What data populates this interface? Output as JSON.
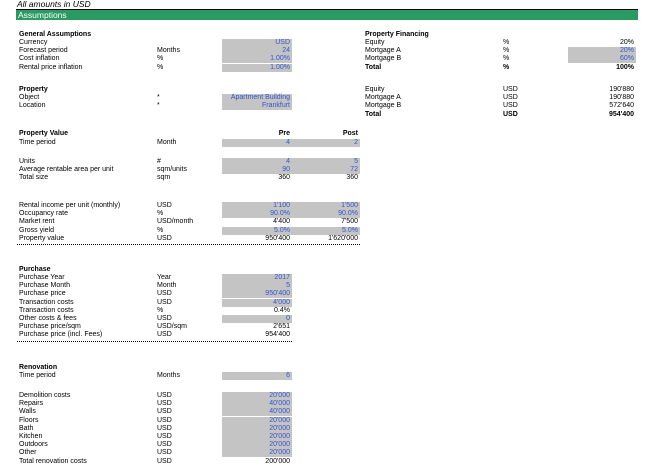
{
  "header": {
    "note": "All amounts in USD",
    "band": "Assumptions"
  },
  "general": {
    "title": "General Assumptions",
    "rows": [
      {
        "label": "Currency",
        "unit": "",
        "value": "USD"
      },
      {
        "label": "Forecast period",
        "unit": "Months",
        "value": "24"
      },
      {
        "label": "Cost inflation",
        "unit": "%",
        "value": "1.00%"
      },
      {
        "label": "Rental price inflation",
        "unit": "%",
        "value": "1.00%"
      }
    ]
  },
  "financing": {
    "title": "Property Financing",
    "rows": [
      {
        "label": "Equity",
        "unit": "%",
        "value": "20%"
      },
      {
        "label": "Mortgage A",
        "unit": "%",
        "value": "20%"
      },
      {
        "label": "Mortgage B",
        "unit": "%",
        "value": "60%"
      },
      {
        "label": "Total",
        "unit": "%",
        "value": "100%"
      }
    ],
    "amounts": [
      {
        "label": "Equity",
        "unit": "USD",
        "value": "190'880"
      },
      {
        "label": "Mortgage A",
        "unit": "USD",
        "value": "190'880"
      },
      {
        "label": "Mortgage B",
        "unit": "USD",
        "value": "572'640"
      },
      {
        "label": "Total",
        "unit": "USD",
        "value": "954'400"
      }
    ]
  },
  "property": {
    "title": "Property",
    "object_label": "Object",
    "object_unit": "*",
    "object_value": "Apartment Building",
    "location_label": "Location",
    "location_unit": "*",
    "location_value": "Frankfurt"
  },
  "property_value": {
    "title": "Property Value",
    "col_pre": "Pre",
    "col_post": "Post",
    "period_label": "Time period",
    "period_unit": "Month",
    "period_pre": "4",
    "period_post": "2",
    "rows1": [
      {
        "label": "Units",
        "unit": "#",
        "pre": "4",
        "post": "5"
      },
      {
        "label": "Average rentable area per unit",
        "unit": "sqm/units",
        "pre": "90",
        "post": "72"
      },
      {
        "label": "Total size",
        "unit": "sqm",
        "pre": "360",
        "post": "360"
      }
    ],
    "rows2": [
      {
        "label": "Rental income per unit (monthly)",
        "unit": "USD",
        "pre": "1'100",
        "post": "1'500"
      },
      {
        "label": "Occupancy rate",
        "unit": "%",
        "pre": "90.0%",
        "post": "90.0%"
      },
      {
        "label": "Market rent",
        "unit": "USD/month",
        "pre": "4'400",
        "post": "7'500"
      },
      {
        "label": "Gross yield",
        "unit": "%",
        "pre": "5.0%",
        "post": "5.0%"
      },
      {
        "label": "Property value",
        "unit": "USD",
        "pre": "950'400",
        "post": "1'620'000"
      }
    ]
  },
  "purchase": {
    "title": "Purchase",
    "rows": [
      {
        "label": "Purchase Year",
        "unit": "Year",
        "value": "2017"
      },
      {
        "label": "Purchase Month",
        "unit": "Month",
        "value": "5"
      },
      {
        "label": "Purchase price",
        "unit": "USD",
        "value": "950'400"
      },
      {
        "label": "Transaction costs",
        "unit": "USD",
        "value": "4'000"
      },
      {
        "label": "Transaction costs",
        "unit": "%",
        "value": "0.4%"
      },
      {
        "label": "Other costs & fees",
        "unit": "USD",
        "value": "0"
      },
      {
        "label": "Purchase price/sqm",
        "unit": "USD/sqm",
        "value": "2'651"
      },
      {
        "label": "Purchase price (incl. Fees)",
        "unit": "USD",
        "value": "954'400"
      }
    ]
  },
  "renovation": {
    "title": "Renovation",
    "period_label": "Time period",
    "period_unit": "Months",
    "period_value": "6",
    "rows": [
      {
        "label": "Demolition costs",
        "unit": "USD",
        "value": "20'000"
      },
      {
        "label": "Repairs",
        "unit": "USD",
        "value": "40'000"
      },
      {
        "label": "Walls",
        "unit": "USD",
        "value": "40'000"
      },
      {
        "label": "Floors",
        "unit": "USD",
        "value": "20'000"
      },
      {
        "label": "Bath",
        "unit": "USD",
        "value": "20'000"
      },
      {
        "label": "Kitchen",
        "unit": "USD",
        "value": "20'000"
      },
      {
        "label": "Outdoors",
        "unit": "USD",
        "value": "20'000"
      },
      {
        "label": "Other",
        "unit": "USD",
        "value": "20'000"
      },
      {
        "label": "Total renovation costs",
        "unit": "USD",
        "value": "200'000"
      }
    ]
  },
  "colors": {
    "band": "#2a9a62",
    "input_fill": "#c4c4c4",
    "input_text": "#3355cc"
  }
}
